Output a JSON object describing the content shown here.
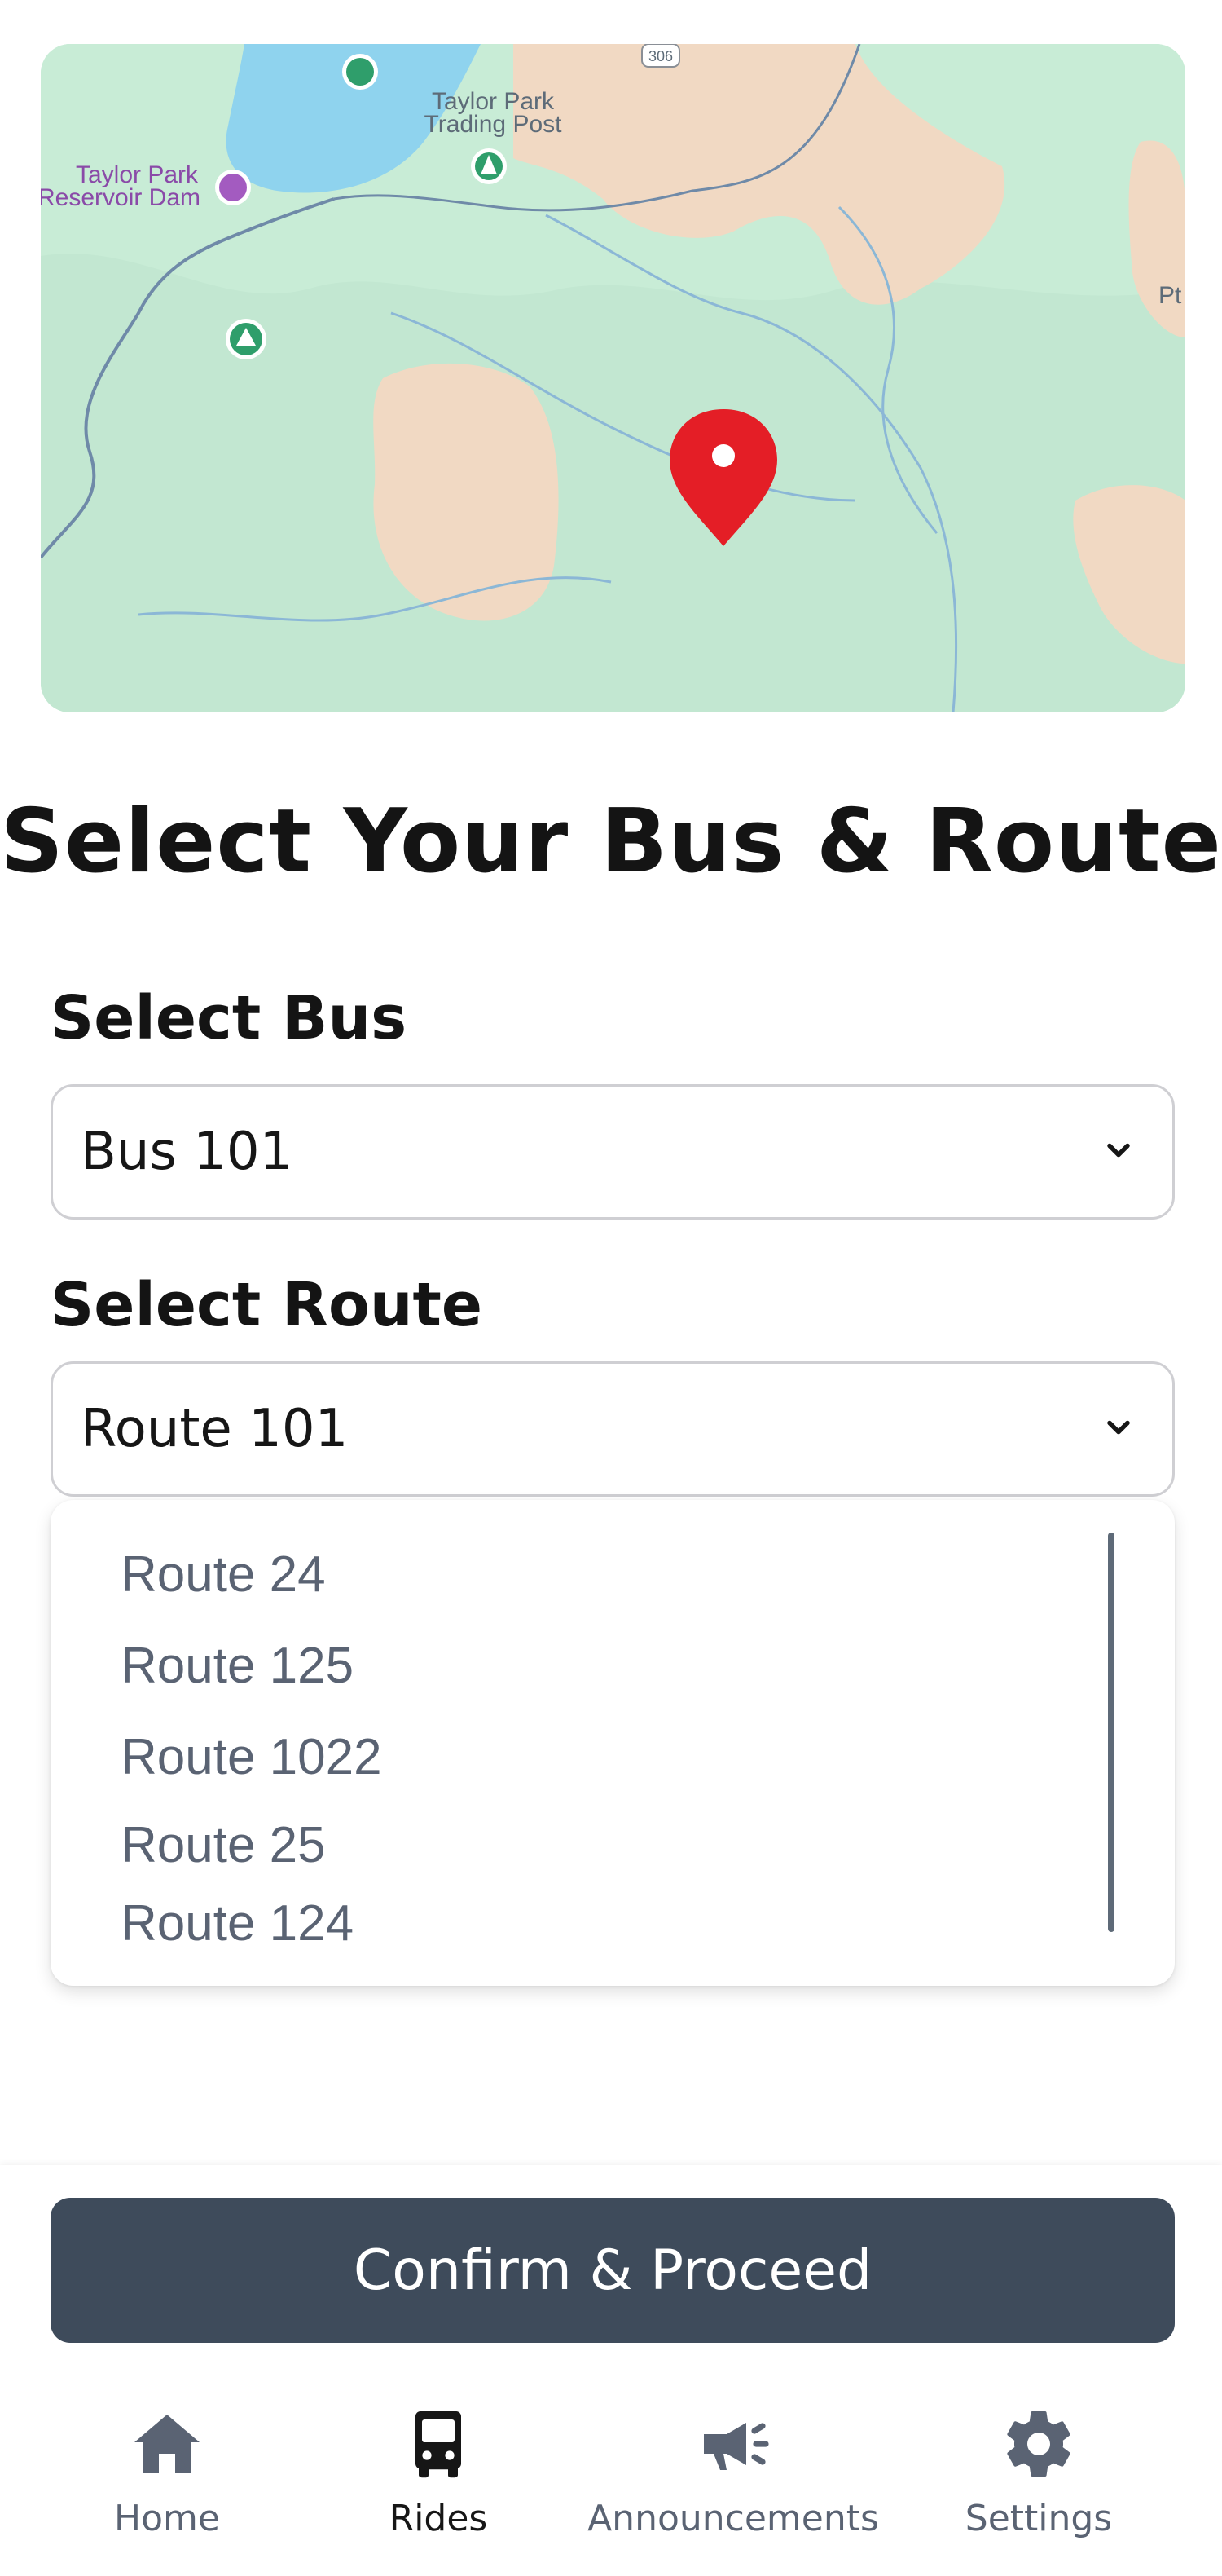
{
  "map": {
    "labels": {
      "trading_post_line1": "Taylor Park",
      "trading_post_line2": "Trading Post",
      "dam_line1": "Taylor Park",
      "dam_line2": "Reservoir Dam",
      "edge_label": "Pt",
      "road_shield": "306"
    },
    "colors": {
      "land": "#c8ecd6",
      "water": "#8fd3ee",
      "sand": "#f1d9c3",
      "marker": "#e41e26"
    }
  },
  "title": "Select Your Bus & Route",
  "bus": {
    "label": "Select Bus",
    "selected": "Bus 101"
  },
  "route": {
    "label": "Select Route",
    "selected": "Route 101",
    "options": [
      "Route 24",
      "Route 125",
      "Route 1022",
      "Route 25",
      "Route 124"
    ]
  },
  "confirm_label": "Confirm & Proceed",
  "nav": {
    "items": [
      {
        "label": "Home",
        "icon": "home-icon"
      },
      {
        "label": "Rides",
        "icon": "bus-icon"
      },
      {
        "label": "Announcements",
        "icon": "megaphone-icon"
      },
      {
        "label": "Settings",
        "icon": "gear-icon"
      }
    ],
    "active": "Rides"
  },
  "colors": {
    "primary_button": "#3e4b5b",
    "muted_text": "#5a6373"
  }
}
